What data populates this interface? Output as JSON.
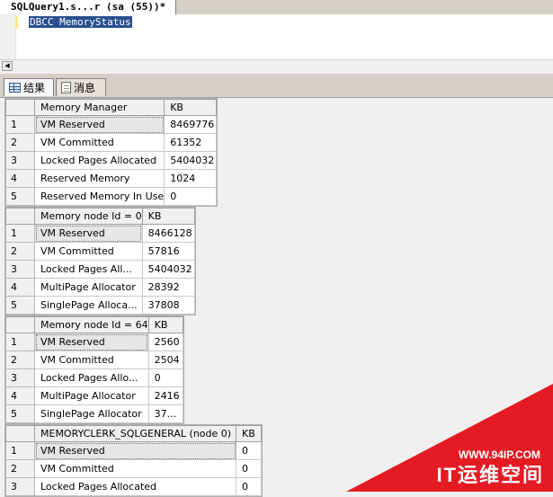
{
  "query_tab": {
    "title": "SQLQuery1.s...r (sa (55))*"
  },
  "editor": {
    "code": "DBCC MemoryStatus"
  },
  "result_tabs": [
    {
      "label": "结果",
      "icon": "grid-icon"
    },
    {
      "label": "消息",
      "icon": "message-icon"
    }
  ],
  "grids": [
    {
      "columns": [
        "Memory Manager",
        "KB"
      ],
      "rows": [
        [
          "1",
          "VM Reserved",
          "8469776"
        ],
        [
          "2",
          "VM Committed",
          "61352"
        ],
        [
          "3",
          "Locked Pages Allocated",
          "5404032"
        ],
        [
          "4",
          "Reserved Memory",
          "1024"
        ],
        [
          "5",
          "Reserved Memory In Use",
          "0"
        ]
      ]
    },
    {
      "columns": [
        "Memory node Id = 0",
        "KB"
      ],
      "rows": [
        [
          "1",
          "VM Reserved",
          "8466128"
        ],
        [
          "2",
          "VM Committed",
          "57816"
        ],
        [
          "3",
          "Locked Pages All...",
          "5404032"
        ],
        [
          "4",
          "MultiPage Allocator",
          "28392"
        ],
        [
          "5",
          "SinglePage Alloca...",
          "37808"
        ]
      ]
    },
    {
      "columns": [
        "Memory node Id = 64",
        "KB"
      ],
      "rows": [
        [
          "1",
          "VM Reserved",
          "2560"
        ],
        [
          "2",
          "VM Committed",
          "2504"
        ],
        [
          "3",
          "Locked Pages Allo...",
          "0"
        ],
        [
          "4",
          "MultiPage Allocator",
          "2416"
        ],
        [
          "5",
          "SinglePage Allocator",
          "37..."
        ]
      ]
    },
    {
      "columns": [
        "MEMORYCLERK_SQLGENERAL (node 0)",
        "KB"
      ],
      "rows": [
        [
          "1",
          "VM Reserved",
          "0"
        ],
        [
          "2",
          "VM Committed",
          "0"
        ],
        [
          "3",
          "Locked Pages Allocated",
          "0"
        ]
      ]
    }
  ],
  "watermark": {
    "url": "WWW.94IP.COM",
    "name": "IT运维空间"
  },
  "colors": {
    "selection": "#2a4f8f",
    "watermark": "#e51b24"
  }
}
